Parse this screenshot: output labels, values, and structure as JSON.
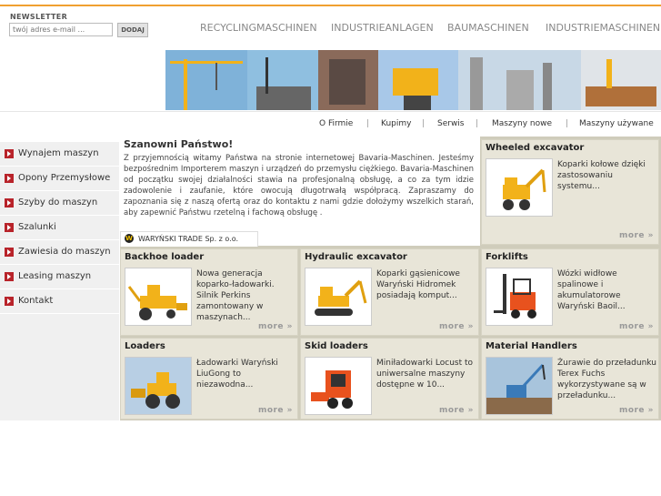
{
  "newsletter": {
    "label": "NEWSLETTER",
    "placeholder": "twój adres e-mail ...",
    "button": "DODAJ"
  },
  "top_nav": [
    "RECYCLINGMASCHINEN",
    "INDUSTRIEANLAGEN",
    "BAUMASCHINEN",
    "INDUSTRIEMASCHINEN"
  ],
  "sub_nav": [
    "O Firmie",
    "Kupimy",
    "Serwis",
    "Maszyny nowe",
    "Maszyny używane"
  ],
  "sub_nav_separator": "|",
  "sidebar": [
    "Wynajem maszyn",
    "Opony Przemysłowe",
    "Szyby do maszyn",
    "Szalunki",
    "Zawiesia do maszyn",
    "Leasing maszyn",
    "Kontakt"
  ],
  "welcome": {
    "title": "Szanowni Państwo!",
    "text": "Z przyjemnością witamy Państwa na stronie internetowej Bavaria-Maschinen. Jesteśmy bezpośrednim Importerem maszyn i urządzeń do przemysłu ciężkiego. Bavaria-Maschinen od początku swojej działalności stawia na profesjonalną obsługę, a co za tym idzie zadowolenie i zaufanie, które owocują długotrwałą współpracą. Zapraszamy do zapoznania się z naszą ofertą oraz do kontaktu z nami gdzie dołożymy wszelkich starań, aby zapewnić Państwu rzetelną i fachową obsługę ."
  },
  "company_tab": {
    "mark": "W",
    "label": "WARYŃSKI TRADE Sp. z o.o."
  },
  "more_label": "more »",
  "cards": [
    {
      "title": "Wheeled excavator",
      "desc": "Koparki kołowe dzięki zastosowaniu systemu..."
    },
    {
      "title": "Backhoe loader",
      "desc": "Nowa generacja koparko-ładowarki. Silnik Perkins zamontowany w maszynach..."
    },
    {
      "title": "Hydraulic excavator",
      "desc": "Koparki gąsienicowe Waryński Hidromek posiadają komput..."
    },
    {
      "title": "Forklifts",
      "desc": "Wózki widłowe spalinowe i akumulatorowe Waryński Baoil..."
    },
    {
      "title": "Loaders",
      "desc": "Ładowarki Waryński LiuGong to niezawodna..."
    },
    {
      "title": "Skid loaders",
      "desc": "Miniładowarki Locust to uniwersalne maszyny dostępne w 10..."
    },
    {
      "title": "Material Handlers",
      "desc": "Żurawie do przeładunku Terex Fuchs wykorzystywane są w przeładunku..."
    }
  ],
  "colors": {
    "accent": "#f0a030",
    "sidebar_arrow": "#b8232a",
    "panel": "#cfccbb",
    "card": "#e8e5d8",
    "machine_yellow": "#f2b21a"
  }
}
